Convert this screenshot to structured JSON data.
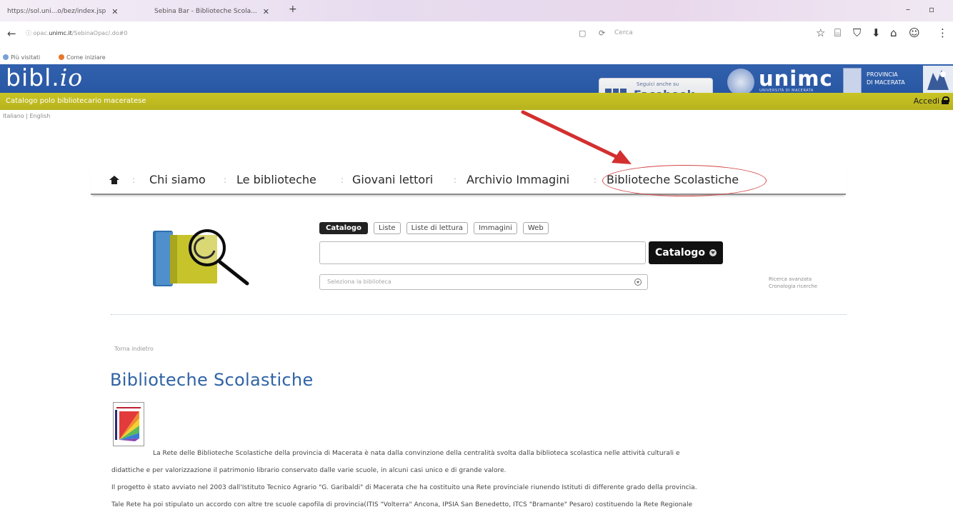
{
  "browser": {
    "tabs": [
      {
        "title": "https://sol.uni...o/bez/index.jsp"
      },
      {
        "title": "Sebina Bar - Biblioteche Scola..."
      }
    ],
    "new_tab": "+",
    "close_glyph": "✕",
    "win_min": "–",
    "win_restore": "▫",
    "back_glyph": "←",
    "url_prefix": "ⓘ opac.",
    "url_domain": "unimc.it",
    "url_path": "/SebinaOpac/.do#0",
    "reload_glyph": "⟳",
    "reader_glyph": "▢",
    "search_placeholder": "Cerca",
    "toolbar_icons": [
      "☆",
      "⌸",
      "⛉",
      "⬇",
      "⌂",
      "☺",
      "⋮"
    ],
    "bookmarks": [
      "Più visitati",
      "Come iniziare"
    ]
  },
  "header": {
    "logo_text": "bibl.",
    "logo_italic": "io",
    "tagline": "Catalogo polo bibliotecario maceratese",
    "facebook_small": "Seguici anche su",
    "facebook_big": "Facebook",
    "unimc": "unimc",
    "unimc_sub": "UNIVERSITÀ DI MACERATA",
    "provincia_line1": "PROVINCIA",
    "provincia_line2": "DI MACERATA",
    "accedi": "Accedi",
    "languages": "Italiano | English"
  },
  "nav": {
    "items": [
      "Chi siamo",
      "Le biblioteche",
      "Giovani lettori",
      "Archivio Immagini",
      "Biblioteche Scolastiche"
    ],
    "separator": ":"
  },
  "search": {
    "tabs": [
      "Catalogo",
      "Liste",
      "Liste di lettura",
      "Immagini",
      "Web"
    ],
    "button": "Catalogo",
    "library_placeholder": "Seleziona la biblioteca",
    "advanced": "Ricerca avanzata",
    "history": "Cronologia ricerche"
  },
  "content": {
    "back": "Torna indietro",
    "title": "Biblioteche Scolastiche",
    "paragraphs": [
      "La Rete delle Biblioteche Scolastiche della provincia di Macerata è nata dalla convinzione della centralità svolta dalla biblioteca scolastica nelle attività culturali e",
      "didattiche e per valorizzazione il patrimonio librario conservato dalle varie scuole, in alcuni casi unico e di grande valore.",
      "Il progetto è stato avviato nel 2003 dall'Istituto Tecnico Agrario \"G. Garibaldi\" di Macerata che ha costituito una Rete provinciale riunendo Istituti di differente grado della provincia.",
      "Tale Rete ha poi stipulato un accordo con altre tre scuole capofila di provincia(ITIS \"Volterra\" Ancona, IPSIA San Benedetto, ITCS \"Bramante\" Pesaro) costituendo la Rete Regionale"
    ]
  },
  "colors": {
    "header_blue": "#2b5aa6",
    "olive": "#bdb81f",
    "title_blue": "#2f63a5",
    "annotation_red": "#d32f2f"
  }
}
